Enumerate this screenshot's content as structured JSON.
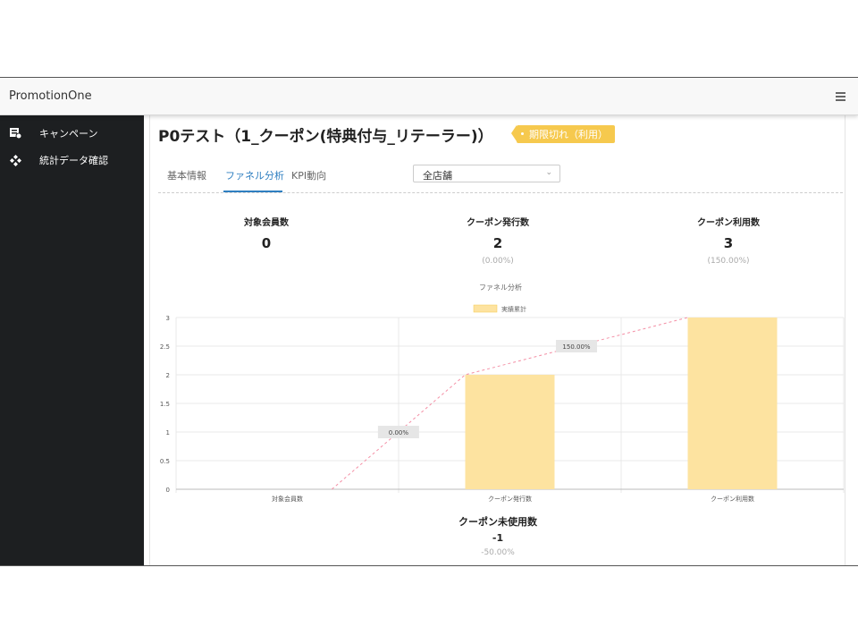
{
  "app": {
    "brand": "PromotionOne"
  },
  "sidebar": {
    "items": [
      {
        "label": "キャンペーン",
        "icon": "campaign-icon"
      },
      {
        "label": "統計データ確認",
        "icon": "diamond-icon"
      }
    ]
  },
  "page": {
    "title": "P0テスト（1_クーポン(特典付与_リテーラー)）",
    "status_badge": "期限切れ（利用）",
    "status_color": "#f6c94e"
  },
  "tabs": [
    {
      "label": "基本情報",
      "active": false
    },
    {
      "label": "ファネル分析",
      "active": true
    },
    {
      "label": "KPI動向",
      "active": false
    }
  ],
  "store_select": {
    "value": "全店舗"
  },
  "stats": [
    {
      "label": "対象会員数",
      "value": "0",
      "pct": ""
    },
    {
      "label": "クーポン発行数",
      "value": "2",
      "pct": "(0.00%)"
    },
    {
      "label": "クーポン利用数",
      "value": "3",
      "pct": "(150.00%)"
    }
  ],
  "unused": {
    "label": "クーポン未使用数",
    "value": "-1",
    "pct": "-50.00%"
  },
  "chart_data": {
    "type": "bar",
    "title": "ファネル分析",
    "categories": [
      "対象会員数",
      "クーポン発行数",
      "クーポン利用数"
    ],
    "series": [
      {
        "name": "実績累計",
        "values": [
          0,
          2,
          3
        ],
        "color": "#fde3a0"
      }
    ],
    "line_annotations": [
      "0.00%",
      "150.00%"
    ],
    "ylim": [
      0,
      3
    ],
    "yticks": [
      "0",
      "0.5",
      "1",
      "1.5",
      "2",
      "2.5",
      "3"
    ],
    "grid": true,
    "legend": "top"
  }
}
